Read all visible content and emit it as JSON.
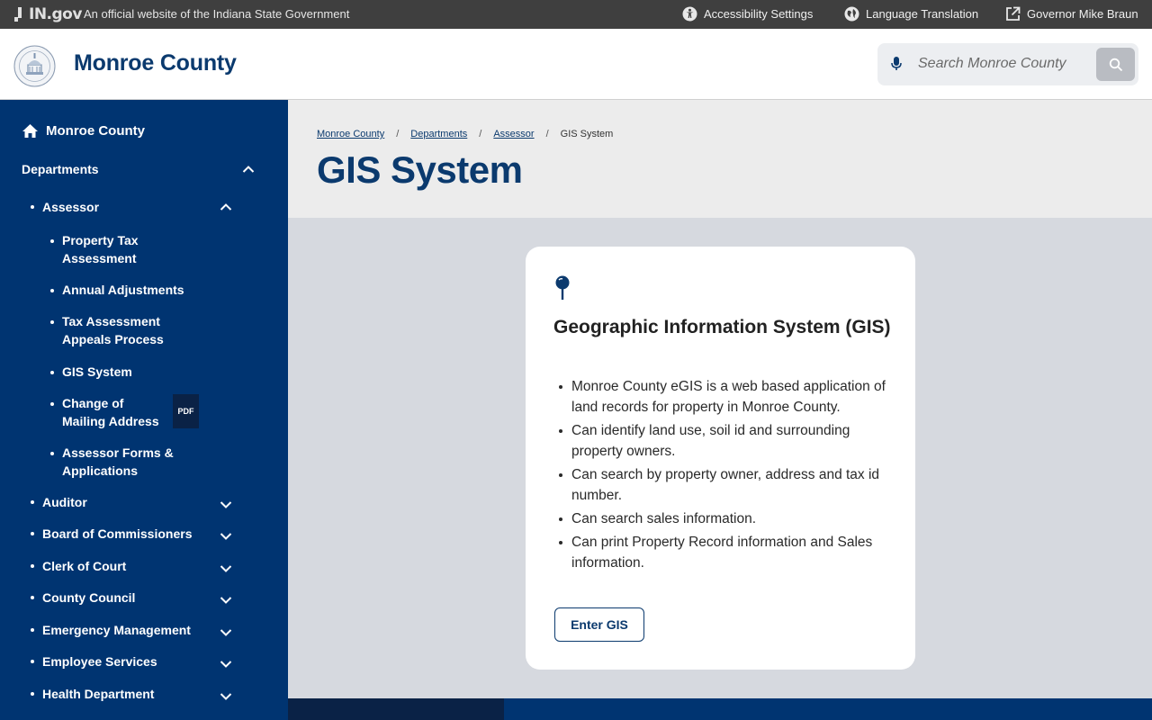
{
  "topbar": {
    "logo_text": "IN.gov",
    "official_text": "An official website of the Indiana State Government",
    "accessibility": "Accessibility Settings",
    "language": "Language Translation",
    "governor": "Governor Mike Braun"
  },
  "header": {
    "site_title": "Monroe County",
    "search_placeholder": "Search Monroe County"
  },
  "sidebar": {
    "home": "Monroe County",
    "departments": "Departments",
    "assessor": "Assessor",
    "assessor_children": [
      "Property Tax Assessment",
      "Annual Adjustments",
      "Tax Assessment Appeals Process",
      "GIS System",
      "Change of Mailing Address",
      "Assessor Forms & Applications"
    ],
    "pdf_badge": "PDF",
    "other_departments": [
      "Auditor",
      "Board of Commissioners",
      "Clerk of Court",
      "County Council",
      "Emergency Management",
      "Employee Services",
      "Health Department"
    ]
  },
  "breadcrumb": [
    "Monroe County",
    "Departments",
    "Assessor",
    "GIS System"
  ],
  "page_title": "GIS System",
  "card": {
    "heading": "Geographic Information System (GIS)",
    "bullets": [
      "Monroe County eGIS is a web based application of land records for property in Monroe County.",
      "Can identify land use, soil id and surrounding property owners.",
      "Can search by property owner, address and tax id number.",
      "Can search sales information.",
      "Can print Property Record information and Sales information."
    ],
    "button": "Enter GIS"
  },
  "colors": {
    "navy": "#003471",
    "title_blue": "#0b3a6e",
    "topbar": "#3f3f3f",
    "banner": "#ececec",
    "page_bg": "#d6d9df"
  }
}
